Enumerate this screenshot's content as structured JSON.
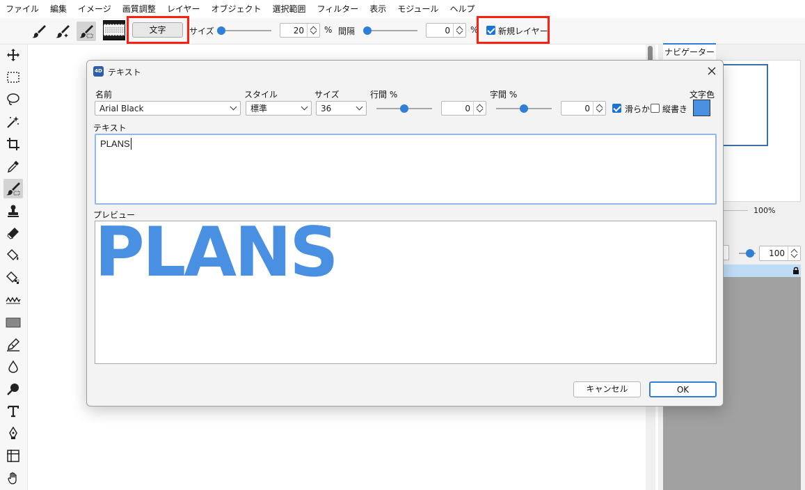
{
  "menu": [
    "ファイル",
    "編集",
    "イメージ",
    "画質調整",
    "レイヤー",
    "オブジェクト",
    "選択範囲",
    "フィルター",
    "表示",
    "モジュール",
    "ヘルプ"
  ],
  "toolbar": {
    "text_button": "文字",
    "size_label": "サイズ",
    "size_value": "20",
    "size_unit": "%",
    "spacing_label": "間隔",
    "spacing_value": "0",
    "spacing_unit": "%",
    "new_layer_label": "新規レイヤー",
    "new_layer_checked": true
  },
  "tools": [
    "move-icon",
    "rect-select-icon",
    "lasso-icon",
    "magic-wand-icon",
    "crop-icon",
    "eyedropper-icon",
    "brush-tool-icon",
    "stamp-icon",
    "eraser-icon",
    "fill-bucket-icon",
    "pattern-fill-icon",
    "wave-icon",
    "rectangle-icon",
    "edit-pen-icon",
    "drop-icon",
    "smudge-icon",
    "text-icon",
    "pen-icon",
    "grid-icon",
    "hand-icon"
  ],
  "right_panel": {
    "navigator_tab": "ナビゲーター",
    "zoom_value": "100%",
    "opacity_value": "100"
  },
  "dialog": {
    "app_badge": "4D",
    "title": "テキスト",
    "font_label": "名前",
    "font_value": "Arial Black",
    "style_label": "スタイル",
    "style_value": "標準",
    "size_label": "サイズ",
    "size_value": "36",
    "line_spacing_label": "行間 %",
    "line_spacing_value": "0",
    "char_spacing_label": "字間 %",
    "char_spacing_value": "0",
    "smooth_label": "滑らか",
    "smooth_checked": true,
    "vertical_label": "縦書き",
    "vertical_checked": false,
    "color_label": "文字色",
    "text_color": "#4a90e2",
    "text_section_label": "テキスト",
    "text_value": "PLANS",
    "preview_label": "プレビュー",
    "preview_text": "PLANS",
    "cancel_label": "キャンセル",
    "ok_label": "OK"
  },
  "colors": {
    "highlight_box": "#ff1f0f",
    "accent": "#2f7ed8",
    "preview_text": "#4a90e2"
  }
}
